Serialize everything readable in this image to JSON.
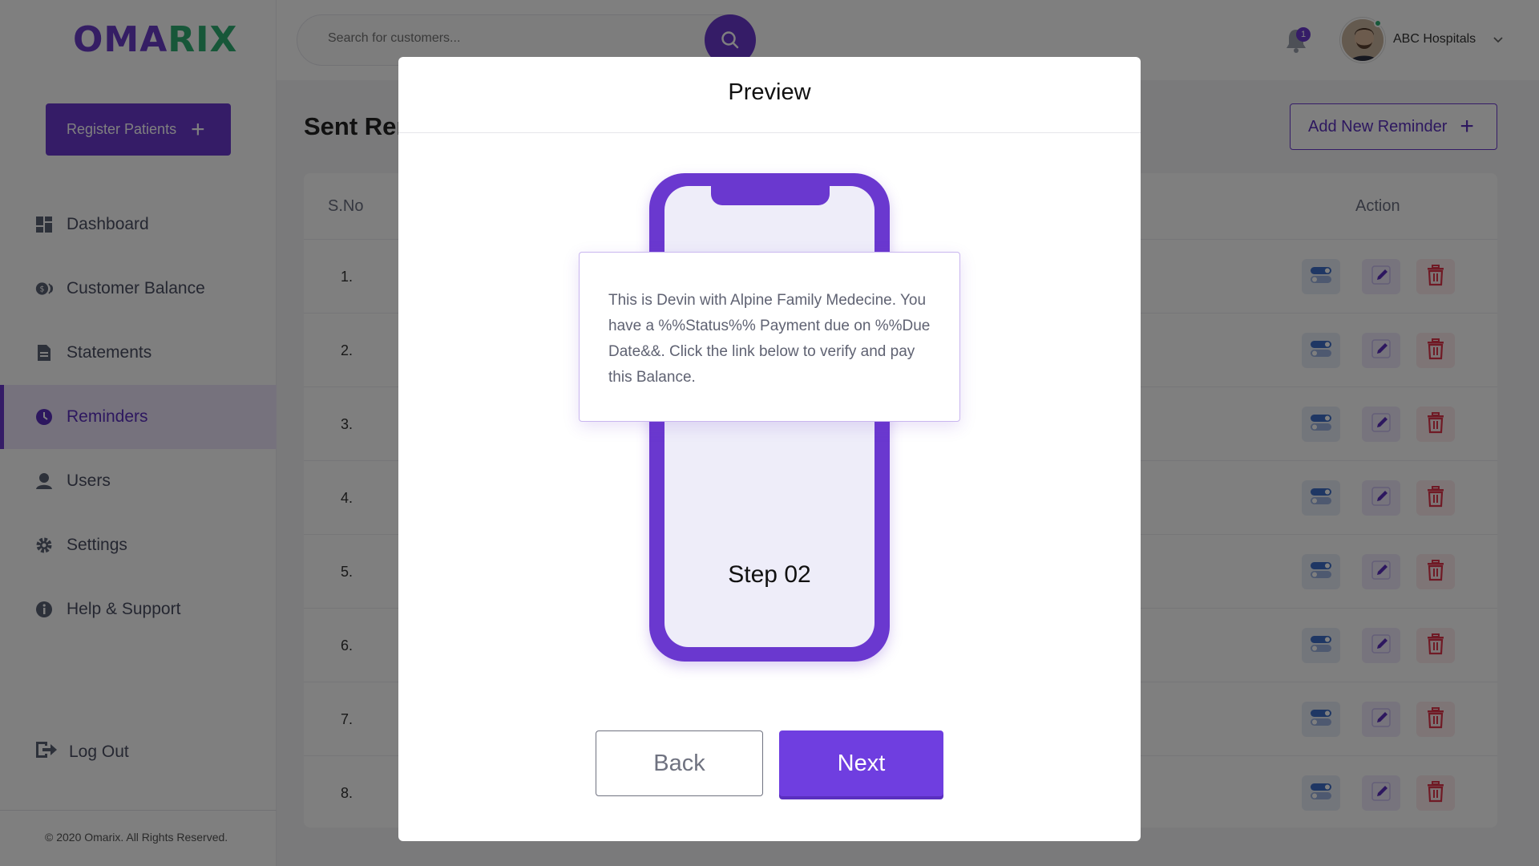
{
  "brand": {
    "part1": "OMA",
    "part2": "RIX",
    "color1": "#6b3cc9",
    "color2": "#2eae72"
  },
  "sidebar": {
    "register_label": "Register Patients",
    "items": [
      {
        "label": "Dashboard",
        "icon": "dashboard-icon"
      },
      {
        "label": "Customer Balance",
        "icon": "balance-icon"
      },
      {
        "label": "Statements",
        "icon": "document-icon"
      },
      {
        "label": "Reminders",
        "icon": "clock-icon",
        "active": true
      },
      {
        "label": "Users",
        "icon": "user-icon"
      },
      {
        "label": "Settings",
        "icon": "gear-icon"
      },
      {
        "label": "Help & Support",
        "icon": "info-icon"
      }
    ],
    "logout_label": "Log Out",
    "copyright": "© 2020 Omarix. All Rights Reserved."
  },
  "header": {
    "search_placeholder": "Search for customers...",
    "notification_count": "1",
    "user_name": "ABC Hospitals"
  },
  "main": {
    "title": "Sent Reminders",
    "add_label": "Add New Reminder",
    "columns": [
      "S.No",
      "Action"
    ],
    "rows": [
      "1.",
      "2.",
      "3.",
      "4.",
      "5.",
      "6.",
      "7.",
      "8."
    ]
  },
  "modal": {
    "title": "Preview",
    "message": "This is Devin with Alpine Family Medecine. You have a %%Status%% Payment due on %%Due Date&&. Click the link below to verify and pay this Balance.",
    "step": "Step 02",
    "back_label": "Back",
    "next_label": "Next"
  },
  "colors": {
    "accent": "#6a38cf",
    "success": "#2eae72",
    "danger": "#e0344b",
    "toggle": "#3f6fc9"
  }
}
